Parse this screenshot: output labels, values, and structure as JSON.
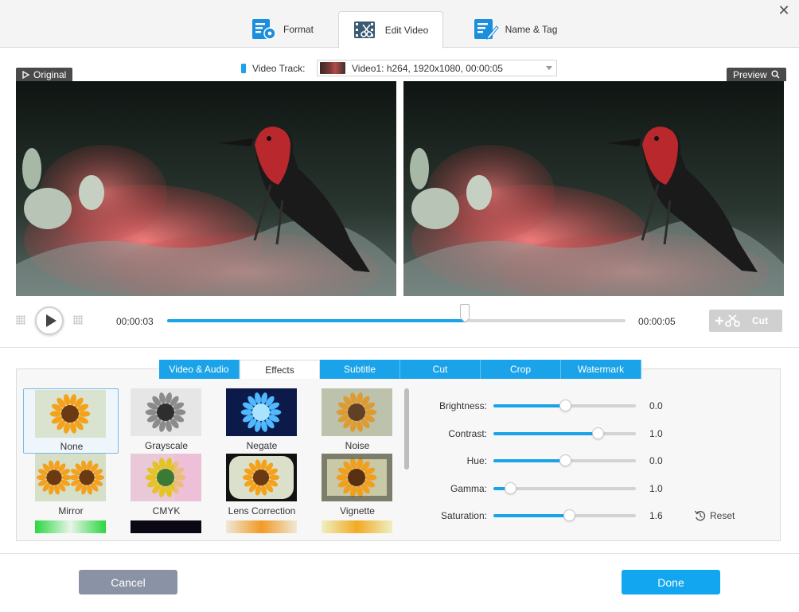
{
  "window": {
    "close_icon": "close-icon"
  },
  "main_tabs": [
    {
      "label": "Format",
      "icon": "format-settings-icon",
      "active": false
    },
    {
      "label": "Edit Video",
      "icon": "edit-video-icon",
      "active": true
    },
    {
      "label": "Name & Tag",
      "icon": "name-tag-icon",
      "active": false
    }
  ],
  "video_track": {
    "label": "Video Track:",
    "value": "Video1: h264, 1920x1080, 00:00:05"
  },
  "panes": {
    "original_label": "Original",
    "preview_label": "Preview"
  },
  "playback": {
    "current_time": "00:00:03",
    "total_time": "00:00:05",
    "progress": 0.65,
    "cut_label": "Cut"
  },
  "effect_tabs": [
    {
      "label": "Video & Audio",
      "active": false
    },
    {
      "label": "Effects",
      "active": true
    },
    {
      "label": "Subtitle",
      "active": false
    },
    {
      "label": "Cut",
      "active": false
    },
    {
      "label": "Crop",
      "active": false
    },
    {
      "label": "Watermark",
      "active": false
    }
  ],
  "effects": [
    {
      "label": "None",
      "selected": true
    },
    {
      "label": "Grayscale",
      "selected": false
    },
    {
      "label": "Negate",
      "selected": false
    },
    {
      "label": "Noise",
      "selected": false
    },
    {
      "label": "Mirror",
      "selected": false
    },
    {
      "label": "CMYK",
      "selected": false
    },
    {
      "label": "Lens Correction",
      "selected": false
    },
    {
      "label": "Vignette",
      "selected": false
    }
  ],
  "adjustments": [
    {
      "label": "Brightness:",
      "value": "0.0",
      "fraction": 0.5
    },
    {
      "label": "Contrast:",
      "value": "1.0",
      "fraction": 0.73
    },
    {
      "label": "Hue:",
      "value": "0.0",
      "fraction": 0.5
    },
    {
      "label": "Gamma:",
      "value": "1.0",
      "fraction": 0.12
    },
    {
      "label": "Saturation:",
      "value": "1.6",
      "fraction": 0.53
    }
  ],
  "reset_label": "Reset",
  "buttons": {
    "cancel": "Cancel",
    "done": "Done"
  },
  "colors": {
    "accent": "#1aa3e8",
    "done": "#12a6f0",
    "cancel": "#8a93a5"
  }
}
